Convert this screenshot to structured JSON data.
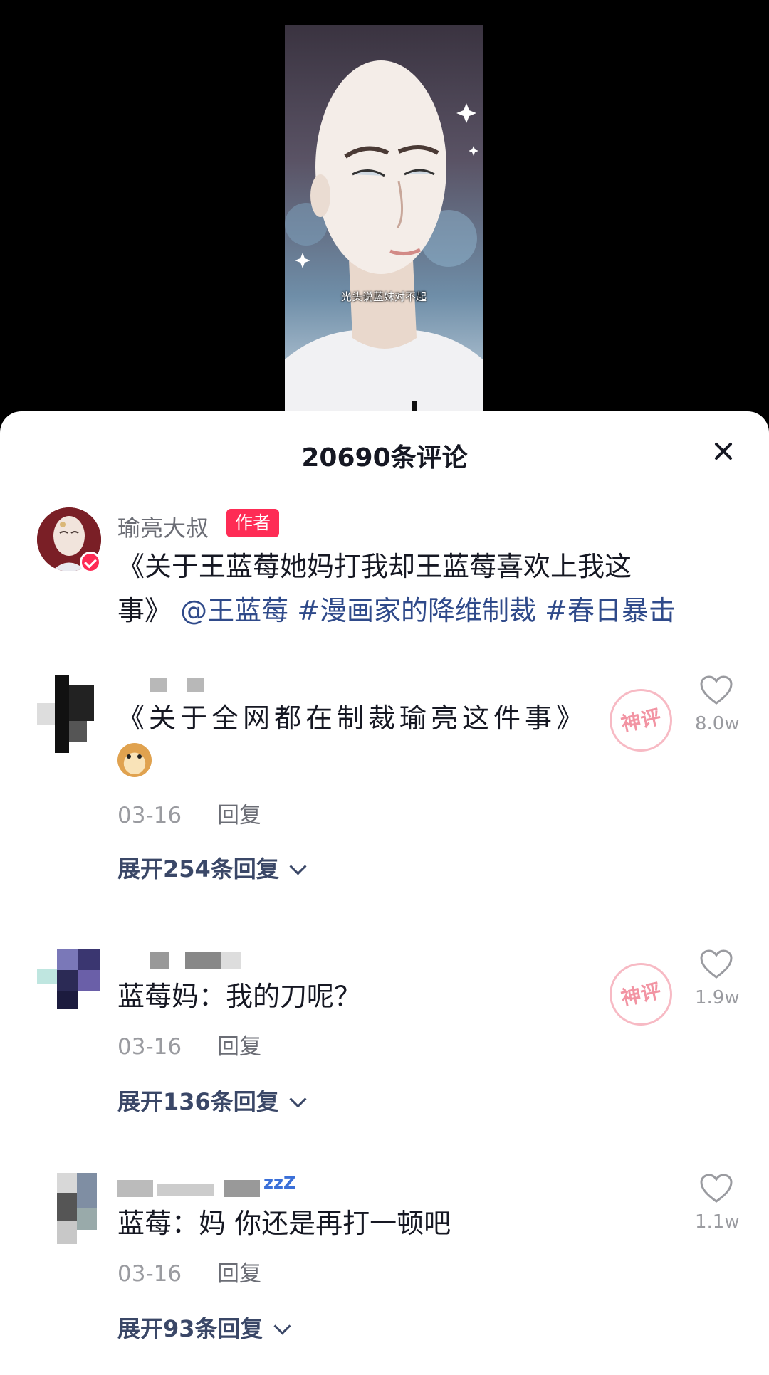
{
  "video": {
    "subtitle": "光头说蓝妹对不起"
  },
  "panel": {
    "title": "20690条评论",
    "close_icon": "close-icon"
  },
  "author_comment": {
    "username": "瑜亮大叔",
    "tag": "作者",
    "text_line1": "《关于王蓝莓她妈打我却王蓝莓喜欢上我这",
    "text_line2_plain": "事》",
    "mention": "@王蓝莓",
    "hashtag1": "#漫画家的降维制裁",
    "hashtag2": "#春日暴击"
  },
  "comments": [
    {
      "text": "《关于全网都在制裁瑜亮这件事》",
      "emoji": "doge-emoji",
      "date": "03-16",
      "reply_label": "回复",
      "expand_label": "展开254条回复",
      "likes": "8.0w",
      "stamp": "神评"
    },
    {
      "text": "蓝莓妈：我的刀呢？",
      "date": "03-16",
      "reply_label": "回复",
      "expand_label": "展开136条回复",
      "likes": "1.9w",
      "stamp": "神评"
    },
    {
      "text": "蓝莓：妈 你还是再打一顿吧",
      "date": "03-16",
      "reply_label": "回复",
      "expand_label": "展开93条回复",
      "likes": "1.1w",
      "name_suffix": "zzZ"
    }
  ],
  "colors": {
    "accent": "#fe2c55",
    "link": "#2f4a8a",
    "text": "#161823",
    "muted": "#9a9ba0"
  }
}
